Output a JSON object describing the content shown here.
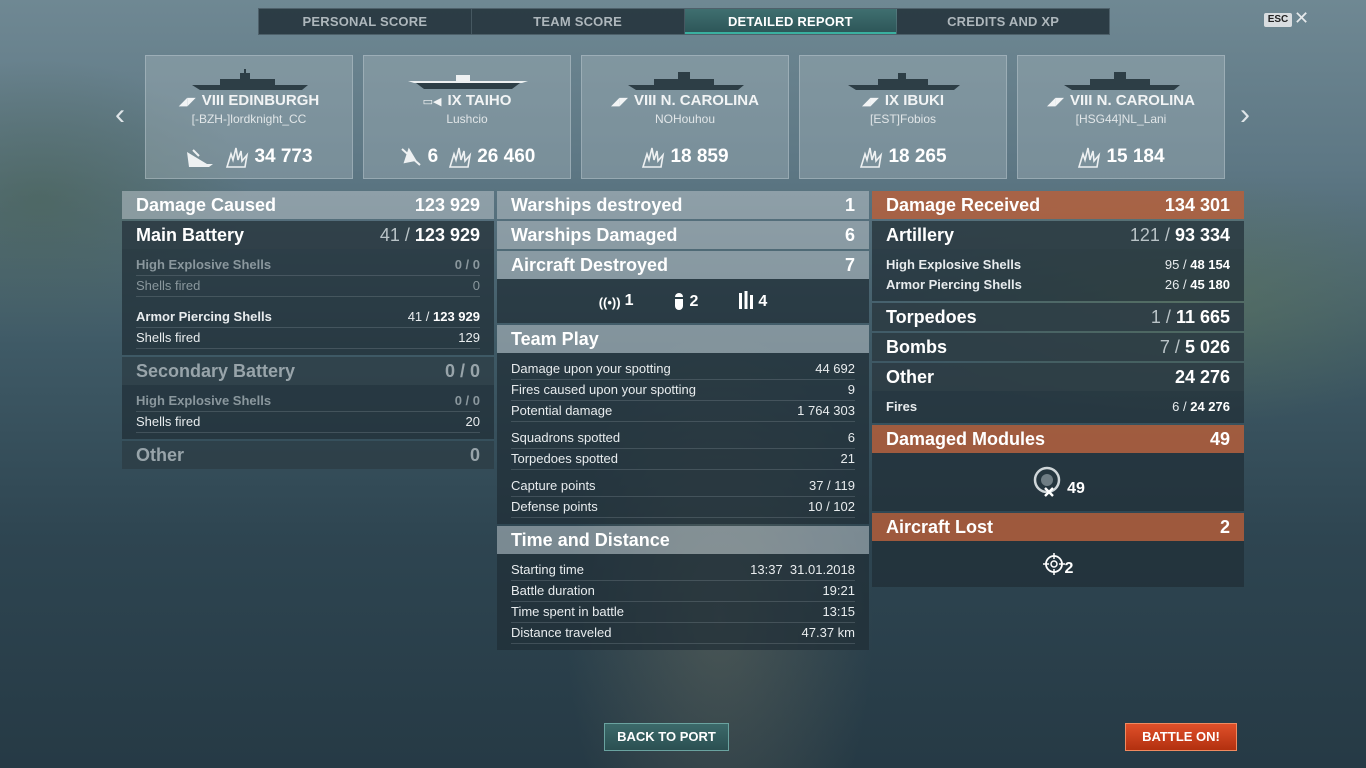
{
  "tabs": [
    "PERSONAL SCORE",
    "TEAM SCORE",
    "DETAILED REPORT",
    "CREDITS AND XP"
  ],
  "active_tab": "DETAILED REPORT",
  "esc_label": "ESC",
  "close_glyph": "✕",
  "nav": {
    "prev": "‹",
    "next": "›"
  },
  "ships": [
    {
      "name": "VIII EDINBURGH",
      "player": "[-BZH-]lordknight_CC",
      "class_icon": "cruiser-icon",
      "stat1_icon": "ship-sunk-icon",
      "stat1": "",
      "damage": "34 773"
    },
    {
      "name": "IX TAIHO",
      "player": "Lushcio",
      "class_icon": "carrier-icon",
      "stat1_icon": "plane-destroyed-icon",
      "stat1": "6",
      "damage": "26 460"
    },
    {
      "name": "VIII N. CAROLINA",
      "player": "NOHouhou",
      "class_icon": "battleship-icon",
      "damage": "18 859"
    },
    {
      "name": "IX IBUKI",
      "player": "[EST]Fobios",
      "class_icon": "cruiser-icon",
      "damage": "18 265"
    },
    {
      "name": "VIII N. CAROLINA",
      "player": "[HSG44]NL_Lani",
      "class_icon": "battleship-icon",
      "damage": "15 184"
    }
  ],
  "left": {
    "damage_caused": {
      "label": "Damage Caused",
      "value": "123 929"
    },
    "main_battery": {
      "label": "Main Battery",
      "hits": "41 /",
      "value": "123 929"
    },
    "he_main": {
      "label": "High Explosive Shells",
      "value": "0 / 0"
    },
    "he_main_fired": {
      "label": "Shells fired",
      "value": "0"
    },
    "ap_main": {
      "label": "Armor Piercing Shells",
      "hits": "41 /",
      "value": "123 929"
    },
    "ap_main_fired": {
      "label": "Shells fired",
      "value": "129"
    },
    "secondary": {
      "label": "Secondary Battery",
      "value": "0 / 0"
    },
    "he_sec": {
      "label": "High Explosive Shells",
      "value": "0 / 0"
    },
    "he_sec_fired": {
      "label": "Shells fired",
      "value": "20"
    },
    "other": {
      "label": "Other",
      "value": "0"
    }
  },
  "middle": {
    "warships_destroyed": {
      "label": "Warships destroyed",
      "value": "1"
    },
    "warships_damaged": {
      "label": "Warships Damaged",
      "value": "6"
    },
    "aircraft_destroyed": {
      "label": "Aircraft Destroyed",
      "value": "7"
    },
    "aircraft_icons": [
      {
        "icon": "fighter-icon",
        "value": "1"
      },
      {
        "icon": "torpedo-bomber-icon",
        "value": "2"
      },
      {
        "icon": "dive-bomber-icon",
        "value": "4"
      }
    ],
    "team_play": {
      "label": "Team Play",
      "rows": [
        {
          "label": "Damage upon your spotting",
          "value": "44 692"
        },
        {
          "label": "Fires caused upon your spotting",
          "value": "9"
        },
        {
          "label": "Potential damage",
          "value": "1 764 303"
        },
        {
          "label": "Squadrons spotted",
          "value": "6"
        },
        {
          "label": "Torpedoes spotted",
          "value": "21"
        },
        {
          "label": "Capture points",
          "value": "37 / 119"
        },
        {
          "label": "Defense points",
          "value": "10 / 102"
        }
      ]
    },
    "time_distance": {
      "label": "Time and Distance",
      "rows": [
        {
          "label": "Starting time",
          "value": "13:37  31.01.2018"
        },
        {
          "label": "Battle duration",
          "value": "19:21"
        },
        {
          "label": "Time spent in battle",
          "value": "13:15"
        },
        {
          "label": "Distance traveled",
          "value": "47.37 km"
        }
      ]
    }
  },
  "right": {
    "damage_received": {
      "label": "Damage Received",
      "value": "134 301"
    },
    "artillery": {
      "label": "Artillery",
      "hits": "121 /",
      "value": "93 334"
    },
    "he": {
      "label": "High Explosive Shells",
      "hits": "95 /",
      "value": "48 154"
    },
    "ap": {
      "label": "Armor Piercing Shells",
      "hits": "26 /",
      "value": "45 180"
    },
    "torpedoes": {
      "label": "Torpedoes",
      "hits": "1 /",
      "value": "11 665"
    },
    "bombs": {
      "label": "Bombs",
      "hits": "7 /",
      "value": "5 026"
    },
    "other": {
      "label": "Other",
      "value": "24 276"
    },
    "fires": {
      "label": "Fires",
      "hits": "6 /",
      "value": "24 276"
    },
    "damaged_modules": {
      "label": "Damaged Modules",
      "value": "49",
      "icon_value": "49"
    },
    "aircraft_lost": {
      "label": "Aircraft Lost",
      "value": "2",
      "icon_value": "2"
    }
  },
  "buttons": {
    "back_to_port": "BACK TO PORT",
    "battle_on": "BATTLE ON!"
  },
  "colors": {
    "accent_teal": "#2c5457",
    "header_orange": "#be5f37",
    "battle_button": "#d2421c"
  }
}
